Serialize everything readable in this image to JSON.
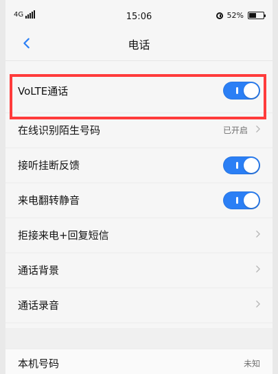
{
  "status": {
    "network": "4G",
    "time": "15:06",
    "battery": "52%",
    "battery_level": 0.52
  },
  "header": {
    "title": "电话"
  },
  "settings": [
    {
      "label": "VoLTE通话",
      "type": "toggle",
      "on": true
    },
    {
      "label": "在线识别陌生号码",
      "type": "value",
      "value": "已开启"
    },
    {
      "label": "接听挂断反馈",
      "type": "toggle",
      "on": true
    },
    {
      "label": "来电翻转静音",
      "type": "toggle",
      "on": true
    },
    {
      "label": "拒接来电+回复短信",
      "type": "nav"
    },
    {
      "label": "通话背景",
      "type": "nav"
    },
    {
      "label": "通话录音",
      "type": "nav"
    }
  ],
  "bottom": {
    "label": "本机号码",
    "value": "未知"
  },
  "colors": {
    "accent": "#2b7ff5",
    "highlight": "#ff3b3b"
  }
}
